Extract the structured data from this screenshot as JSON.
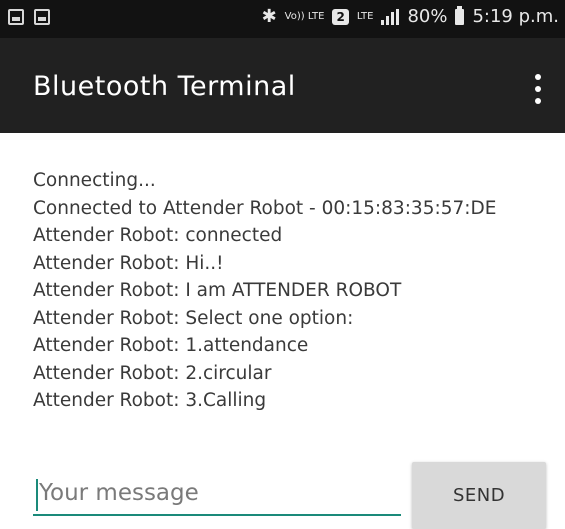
{
  "status_bar": {
    "icons_left": [
      "image-icon",
      "notification-icon"
    ],
    "bluetooth_icon": "bluetooth-icon",
    "volte_label": "Vo)) LTE",
    "sim_label": "2",
    "lte_label": "LTE",
    "battery_text": "80%",
    "time": "5:19 p.m."
  },
  "app_bar": {
    "title": "Bluetooth Terminal",
    "menu_icon": "overflow-menu-icon"
  },
  "log": {
    "lines": [
      "Connecting...",
      "Connected to Attender Robot - 00:15:83:35:57:DE",
      "Attender Robot: connected",
      "Attender Robot: Hi..!",
      "Attender Robot: I am ATTENDER ROBOT",
      "Attender Robot: Select one option:",
      "Attender Robot: 1.attendance",
      "Attender Robot: 2.circular",
      "Attender Robot: 3.Calling"
    ]
  },
  "composer": {
    "placeholder": "Your message",
    "value": "",
    "send_label": "SEND"
  },
  "colors": {
    "status_bar_bg": "#121212",
    "app_bar_bg": "#212121",
    "accent": "#1a8a7a",
    "button_bg": "#d9d9d9"
  }
}
